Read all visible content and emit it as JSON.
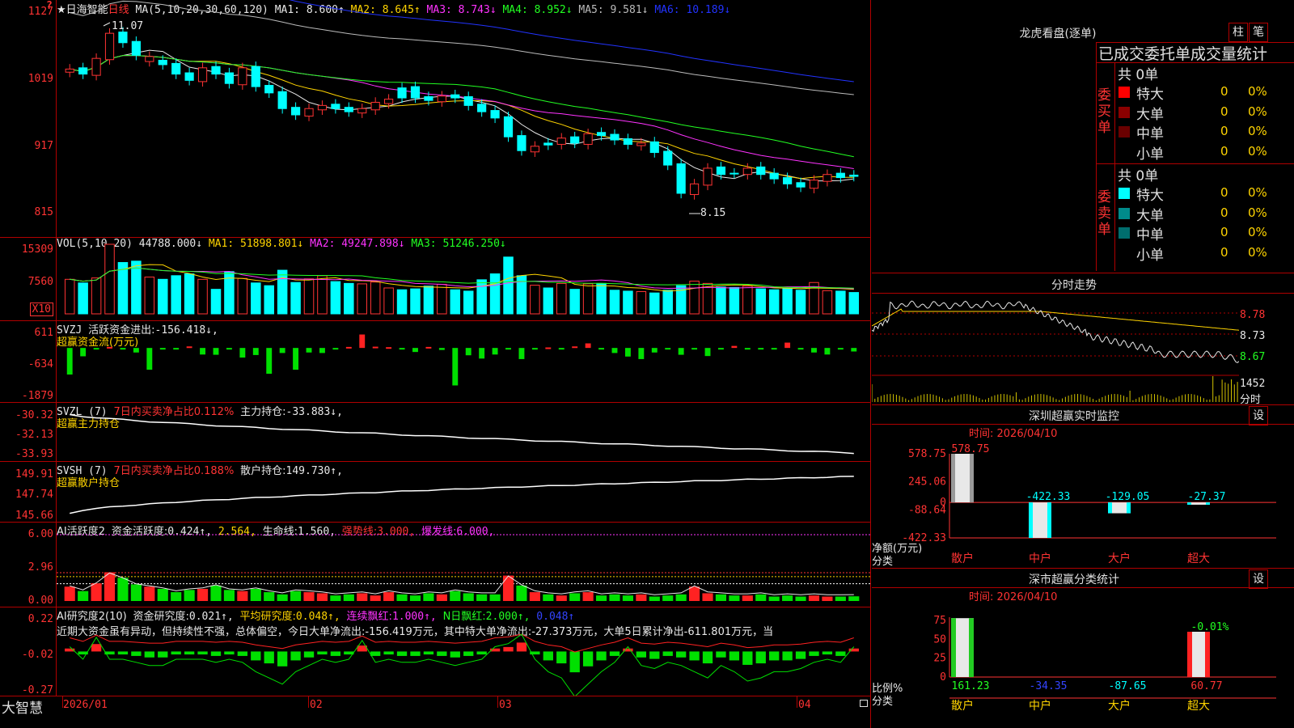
{
  "corner_mark": "?",
  "stock": {
    "name": "★日海智能",
    "period": "日线",
    "ma_label": "MA(5,10,20,30,60,120)",
    "ma": [
      {
        "label": "MA1:",
        "value": "8.600↑",
        "color": "#e8e8e8"
      },
      {
        "label": "MA2:",
        "value": "8.645↑",
        "color": "#ffd400"
      },
      {
        "label": "MA3:",
        "value": "8.743↓",
        "color": "#ff33ff"
      },
      {
        "label": "MA4:",
        "value": "8.952↓",
        "color": "#22ff22"
      },
      {
        "label": "MA5:",
        "value": "9.581↓",
        "color": "#bbbbbb"
      },
      {
        "label": "MA6:",
        "value": "10.189↓",
        "color": "#2233ff"
      }
    ],
    "high_mark": "11.07",
    "low_mark": "8.15",
    "y_ticks": [
      "1127",
      "1019",
      "917",
      "815"
    ]
  },
  "vol": {
    "label": "VOL(5,10,20)",
    "value": "44788.000↓",
    "ma": [
      {
        "label": "MA1:",
        "value": "51898.801↓",
        "color": "#ffd400"
      },
      {
        "label": "MA2:",
        "value": "49247.898↓",
        "color": "#ff33ff"
      },
      {
        "label": "MA3:",
        "value": "51246.250↓",
        "color": "#22ff22"
      }
    ],
    "y_ticks": [
      "15309",
      "7560"
    ],
    "unit": "X10"
  },
  "svzj": {
    "label": "SVZJ",
    "text1": "活跃资金进出:",
    "value": "-156.418↓,",
    "title": "超赢资金流(万元)",
    "y_ticks": [
      "611",
      "-634",
      "-1879"
    ]
  },
  "svzl": {
    "label": "SVZL (7)",
    "red_text": "7日内买卖净占比0.112%",
    "text": "主力持仓:",
    "value": "-33.883↓,",
    "title": "超赢主力持仓",
    "y_ticks": [
      "-30.32",
      "-32.13",
      "-33.93"
    ]
  },
  "svsh": {
    "label": "SVSH (7)",
    "red_text": "7日内买卖净占比0.188%",
    "text": "散户持仓:",
    "value": "149.730↑,",
    "title": "超赢散户持仓",
    "y_ticks": [
      "149.91",
      "147.74",
      "145.66"
    ]
  },
  "ai1": {
    "label": "AI活跃度2",
    "t1": "资金活跃度:",
    "v1": "0.424↑,",
    "v2": "2.564,",
    "t3": "生命线:",
    "v3": "1.560,",
    "t4": "强势线:",
    "v4": "3.000,",
    "t5": "爆发线:",
    "v5": "6.000,",
    "y_ticks": [
      "6.00",
      "2.96",
      "0.00"
    ]
  },
  "ai2": {
    "label": "AI研究度2(10)",
    "t1": "资金研究度:",
    "v1": "0.021↑,",
    "t2": "平均研究度:",
    "v2": "0.048↑,",
    "t3": "连续飘红:",
    "v3": "1.000↑,",
    "t4": "N日飘红:",
    "v4": "2.000↑,",
    "v5": "0.048↑",
    "comment": "近期大资金虽有异动，但持续性不强，总体偏空，今日大单净流出:-156.419万元，其中特大单净流出:-27.373万元，大单5日累计净出-611.801万元，当",
    "y_ticks": [
      "0.22",
      "-0.02",
      "-0.27"
    ]
  },
  "xaxis": {
    "labels": [
      "2026/01",
      "02",
      "03",
      "04"
    ]
  },
  "brand": "大智慧",
  "right": {
    "tabs": [
      "柱",
      "笔"
    ],
    "dragon_title": "龙虎看盘(逐单)",
    "stat_title": "已成交委托单成交量统计",
    "buy": {
      "side_label": "委买单",
      "total": "共 0单",
      "rows": [
        {
          "name": "特大",
          "vol": "0",
          "pct": "0%",
          "color": "#ff0000"
        },
        {
          "name": "大单",
          "vol": "0",
          "pct": "0%",
          "color": "#8b0000"
        },
        {
          "name": "中单",
          "vol": "0",
          "pct": "0%",
          "color": "#6a0000"
        },
        {
          "name": "小单",
          "vol": "0",
          "pct": "0%",
          "color": "#000000"
        }
      ]
    },
    "sell": {
      "side_label": "委卖单",
      "total": "共 0单",
      "rows": [
        {
          "name": "特大",
          "vol": "0",
          "pct": "0%",
          "color": "#00ffff"
        },
        {
          "name": "大单",
          "vol": "0",
          "pct": "0%",
          "color": "#008b8b"
        },
        {
          "name": "中单",
          "vol": "0",
          "pct": "0%",
          "color": "#006e6e"
        },
        {
          "name": "小单",
          "vol": "0",
          "pct": "0%",
          "color": "#000000"
        }
      ]
    },
    "intraday": {
      "title": "分时走势",
      "y_ticks": [
        "8.78",
        "8.73",
        "8.67"
      ],
      "vol_tick": "1452",
      "unit": "分时"
    },
    "monitor": {
      "title": "深圳超赢实时监控",
      "set": "设",
      "time": "时间: 2026/04/10",
      "y_ticks": [
        "578.75",
        "245.06",
        "0",
        "-88.64",
        "-422.33"
      ],
      "ylabel": "净额(万元)",
      "xlabel": "分类",
      "categories": [
        "散户",
        "中户",
        "大户",
        "超大"
      ],
      "values_text": [
        "578.75",
        "-422.33",
        "-129.05",
        "-27.37"
      ]
    },
    "classify": {
      "title": "深市超赢分类统计",
      "set": "设",
      "time": "时间: 2026/04/10",
      "y_ticks": [
        "75",
        "50",
        "25",
        "0"
      ],
      "ylabel": "比例%",
      "xlabel": "分类",
      "categories": [
        "散户",
        "中户",
        "大户",
        "超大"
      ],
      "bottom_values": [
        "161.23",
        "-34.35",
        "-87.65",
        "60.77"
      ],
      "top_label": "-0.01%"
    }
  },
  "chart_data": [
    {
      "type": "candlestick",
      "title": "日海智能 日线",
      "x_labels": [
        "2026/01",
        "02",
        "03",
        "04"
      ],
      "ylim": [
        8.0,
        11.3
      ],
      "high": 11.07,
      "low": 8.15,
      "close": [
        10.38,
        10.3,
        10.55,
        10.95,
        10.8,
        10.6,
        10.5,
        10.45,
        10.3,
        10.2,
        10.4,
        10.3,
        10.15,
        10.4,
        10.1,
        10.0,
        9.75,
        9.65,
        9.75,
        9.8,
        9.75,
        9.7,
        9.75,
        9.85,
        9.9,
        10.08,
        9.92,
        9.88,
        9.95,
        9.92,
        9.8,
        9.7,
        9.6,
        9.3,
        9.08,
        9.15,
        9.2,
        9.28,
        9.2,
        9.35,
        9.32,
        9.25,
        9.18,
        9.2,
        9.05,
        8.85,
        8.4,
        8.55,
        8.8,
        8.7,
        8.72,
        8.8,
        8.7,
        8.63,
        8.55,
        8.5,
        8.61,
        8.7,
        8.65,
        8.69
      ],
      "up": [
        1,
        0,
        1,
        1,
        0,
        0,
        1,
        0,
        0,
        0,
        1,
        0,
        0,
        1,
        0,
        0,
        0,
        0,
        1,
        1,
        0,
        0,
        1,
        1,
        1,
        0,
        0,
        0,
        1,
        0,
        0,
        0,
        0,
        0,
        0,
        1,
        0,
        1,
        0,
        1,
        0,
        0,
        0,
        1,
        0,
        0,
        0,
        1,
        1,
        0,
        0,
        1,
        0,
        0,
        0,
        0,
        1,
        1,
        0,
        0
      ],
      "ma_series": [
        "MA1",
        "MA2",
        "MA3",
        "MA4",
        "MA5",
        "MA6"
      ]
    },
    {
      "type": "bar",
      "title": "VOL(5,10,20)",
      "ylim": [
        0,
        15309
      ],
      "values": [
        7600,
        6800,
        7900,
        15309,
        11300,
        11600,
        8100,
        7600,
        8400,
        8800,
        7600,
        5400,
        9300,
        7800,
        6800,
        6200,
        9600,
        6900,
        7700,
        8400,
        7100,
        6700,
        6600,
        7000,
        5700,
        5300,
        5500,
        6100,
        6500,
        5300,
        5000,
        7500,
        8800,
        12500,
        8400,
        6300,
        5700,
        6700,
        5400,
        6600,
        6700,
        5200,
        5000,
        4900,
        4600,
        5200,
        6200,
        7200,
        6700,
        5900,
        5800,
        6100,
        5500,
        5300,
        5600,
        5200,
        6900,
        5100,
        5000,
        4700
      ],
      "up": [
        1,
        0,
        1,
        1,
        0,
        0,
        1,
        0,
        0,
        0,
        1,
        0,
        0,
        1,
        0,
        0,
        0,
        0,
        1,
        1,
        0,
        0,
        1,
        1,
        1,
        0,
        0,
        0,
        1,
        0,
        0,
        0,
        0,
        0,
        0,
        1,
        0,
        1,
        0,
        1,
        0,
        0,
        0,
        1,
        0,
        0,
        0,
        1,
        1,
        0,
        0,
        1,
        0,
        0,
        0,
        0,
        1,
        1,
        0,
        0
      ]
    },
    {
      "type": "bar",
      "title": "超赢资金流(万元)",
      "ylim": [
        -1879,
        611
      ],
      "values": [
        -1050,
        -330,
        -40,
        40,
        -40,
        -180,
        -860,
        -40,
        -40,
        60,
        -260,
        -270,
        -40,
        -380,
        -280,
        -1020,
        -200,
        -860,
        -180,
        -200,
        -40,
        40,
        530,
        50,
        30,
        -40,
        -160,
        40,
        -80,
        -1480,
        -290,
        -420,
        -260,
        -40,
        -440,
        -40,
        20,
        -40,
        60,
        180,
        -40,
        -200,
        -340,
        -440,
        -180,
        -40,
        -270,
        -40,
        -320,
        -40,
        80,
        -40,
        -40,
        -60,
        210,
        -60,
        -180,
        -260,
        -40,
        -140
      ],
      "last": -156.418
    },
    {
      "type": "line",
      "title": "超赢主力持仓",
      "ylim": [
        -34.2,
        -30.0
      ],
      "last": -33.883
    },
    {
      "type": "line",
      "title": "超赢散户持仓",
      "ylim": [
        145.4,
        150.2
      ],
      "last": 149.73
    },
    {
      "type": "bar",
      "title": "AI活跃度2",
      "ylim": [
        0,
        6.0
      ],
      "lines": {
        "强势线": 3.0,
        "爆发线": 6.0,
        "生命线": 1.56
      },
      "values": [
        1.3,
        0.9,
        1.6,
        2.6,
        2.1,
        1.5,
        1.3,
        1.1,
        0.8,
        1.0,
        1.1,
        1.4,
        1.0,
        0.9,
        1.1,
        0.8,
        0.6,
        0.9,
        0.8,
        0.7,
        0.5,
        0.6,
        0.7,
        0.5,
        0.8,
        0.6,
        0.5,
        0.7,
        0.6,
        0.9,
        0.7,
        0.6,
        0.6,
        2.3,
        1.4,
        0.8,
        0.6,
        0.5,
        0.7,
        0.8,
        0.5,
        0.6,
        0.5,
        0.6,
        0.4,
        0.5,
        0.6,
        1.3,
        0.7,
        0.6,
        0.5,
        0.5,
        0.6,
        0.4,
        0.5,
        0.4,
        0.5,
        0.4,
        0.4,
        0.424
      ],
      "up": [
        1,
        0,
        1,
        1,
        0,
        0,
        1,
        0,
        0,
        0,
        1,
        0,
        0,
        1,
        0,
        0,
        0,
        0,
        1,
        1,
        0,
        0,
        1,
        1,
        1,
        0,
        0,
        0,
        1,
        0,
        0,
        0,
        0,
        1,
        0,
        1,
        0,
        1,
        0,
        1,
        0,
        0,
        0,
        1,
        0,
        0,
        0,
        1,
        1,
        0,
        0,
        1,
        0,
        0,
        0,
        0,
        1,
        1,
        0,
        0
      ]
    },
    {
      "type": "bar",
      "title": "AI研究度2(10)",
      "ylim": [
        -0.27,
        0.22
      ],
      "values": [
        0.02,
        -0.02,
        0.05,
        -0.02,
        -0.02,
        -0.03,
        -0.04,
        -0.04,
        -0.02,
        -0.02,
        -0.02,
        -0.03,
        -0.02,
        -0.03,
        -0.06,
        -0.08,
        -0.1,
        -0.06,
        -0.04,
        -0.02,
        -0.03,
        -0.02,
        0.04,
        -0.03,
        -0.02,
        -0.03,
        -0.03,
        -0.02,
        -0.03,
        -0.04,
        -0.03,
        -0.02,
        0.02,
        0.03,
        0.06,
        -0.02,
        -0.06,
        -0.08,
        -0.14,
        -0.1,
        -0.06,
        -0.03,
        0.02,
        -0.04,
        -0.05,
        -0.03,
        -0.04,
        -0.06,
        -0.08,
        -0.04,
        -0.06,
        -0.09,
        -0.08,
        -0.06,
        -0.06,
        -0.05,
        -0.03,
        -0.02,
        -0.03,
        0.02
      ]
    },
    {
      "type": "bar",
      "title": "深圳超赢实时监控",
      "categories": [
        "散户",
        "中户",
        "大户",
        "超大"
      ],
      "values": [
        578.75,
        -422.33,
        -129.05,
        -27.37
      ],
      "ylim": [
        -422.33,
        578.75
      ]
    },
    {
      "type": "bar",
      "title": "深市超赢分类统计",
      "categories": [
        "散户",
        "中户",
        "大户",
        "超大"
      ],
      "values": [
        161.23,
        -34.35,
        -87.65,
        60.77
      ],
      "ylim": [
        0,
        75
      ]
    }
  ]
}
